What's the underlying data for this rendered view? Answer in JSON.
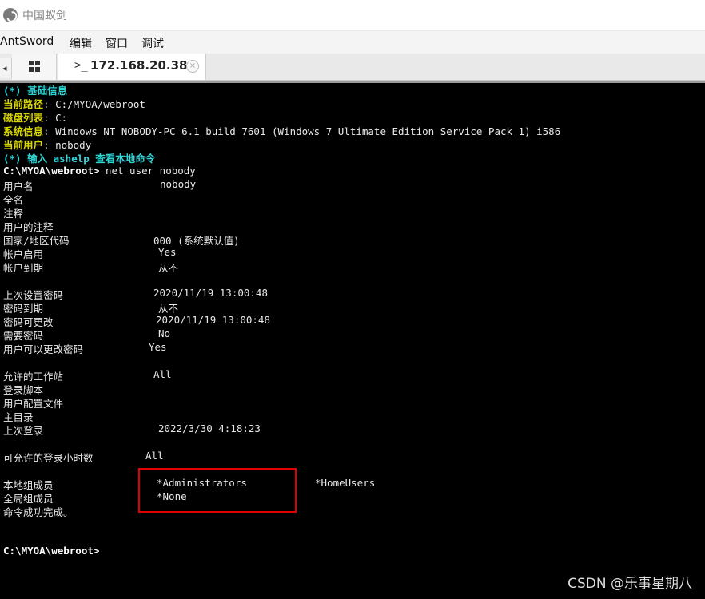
{
  "window": {
    "title": "中国蚁剑"
  },
  "menu": {
    "items": [
      "AntSword",
      "编辑",
      "窗口",
      "调试"
    ]
  },
  "tabs": {
    "active_title": "172.168.20.38",
    "prompt_glyph": ">_",
    "close_glyph": "×",
    "nav_left": "◂"
  },
  "terminal": {
    "info_title": "(*) 基础信息",
    "current_path_label": "当前路径",
    "current_path_value": ": C:/MYOA/webroot",
    "disk_label": "磁盘列表",
    "disk_value": ": C:",
    "system_label": "系统信息",
    "system_value": ": Windows NT NOBODY-PC 6.1 build 7601 (Windows 7 Ultimate Edition Service Pack 1) i586",
    "user_label": "当前用户",
    "user_value": ": nobody",
    "hint": "(*) 输入 ashelp 查看本地命令",
    "prompt": "C:\\MYOA\\webroot>",
    "command": " net user nobody",
    "lines": [
      {
        "label": "用户名",
        "value": "nobody"
      },
      {
        "label": "全名",
        "value": ""
      },
      {
        "label": "注释",
        "value": ""
      },
      {
        "label": "用户的注释",
        "value": ""
      },
      {
        "label": "国家/地区代码",
        "value": "000 (系统默认值)"
      },
      {
        "label": "帐户启用",
        "value": "Yes"
      },
      {
        "label": "帐户到期",
        "value": "从不"
      },
      {
        "label": "上次设置密码",
        "value": "2020/11/19 13:00:48"
      },
      {
        "label": "密码到期",
        "value": "从不"
      },
      {
        "label": "密码可更改",
        "value": "2020/11/19 13:00:48"
      },
      {
        "label": "需要密码",
        "value": "No"
      },
      {
        "label": "用户可以更改密码",
        "value": "Yes"
      },
      {
        "label": "允许的工作站",
        "value": "All"
      },
      {
        "label": "登录脚本",
        "value": ""
      },
      {
        "label": "用户配置文件",
        "value": ""
      },
      {
        "label": "主目录",
        "value": ""
      },
      {
        "label": "上次登录",
        "value": "2022/3/30 4:18:23"
      },
      {
        "label": "可允许的登录小时数",
        "value": "All"
      },
      {
        "label": "本地组成员",
        "value": "*Administrators",
        "value2": "*HomeUsers"
      },
      {
        "label": "全局组成员",
        "value": "*None"
      },
      {
        "label": "命令成功完成。",
        "value": ""
      }
    ],
    "final_prompt": "C:\\MYOA\\webroot>"
  },
  "watermark": "CSDN @乐事星期八",
  "colors": {
    "cyan": "#2fd6d6",
    "yellow": "#d8d600",
    "highlight": "#e10000",
    "background": "#000000"
  }
}
